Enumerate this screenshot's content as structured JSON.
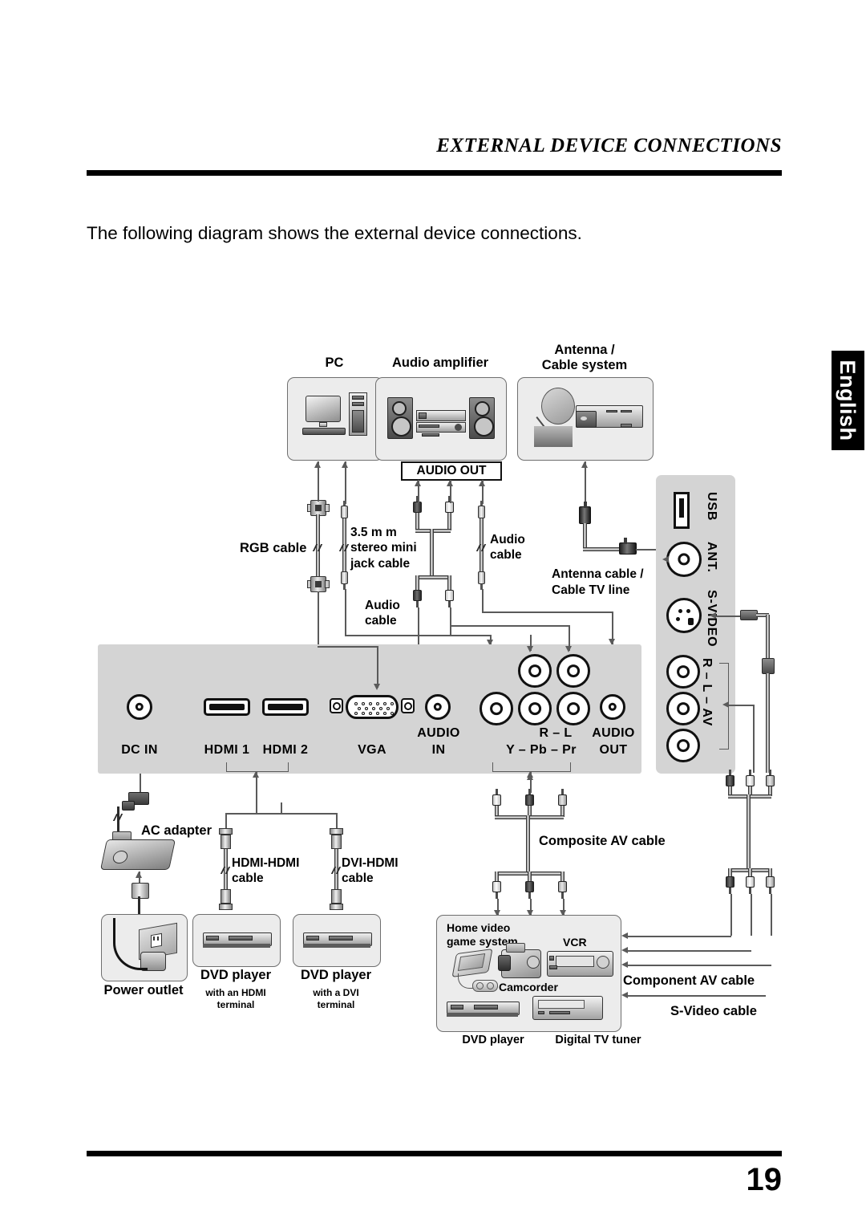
{
  "page": {
    "header_title": "EXTERNAL DEVICE CONNECTIONS",
    "intro_text": "The following diagram shows the external device connections.",
    "page_number": "19",
    "language_tab": "English"
  },
  "top_devices": [
    {
      "name": "pc",
      "label": "PC"
    },
    {
      "name": "audio-amplifier",
      "label": "Audio amplifier"
    },
    {
      "name": "antenna-cable-system",
      "label": "Antenna /\nCable system",
      "line1": "Antenna /",
      "line2": "Cable system"
    }
  ],
  "audio_out_box": {
    "label": "AUDIO OUT"
  },
  "cables_top": [
    {
      "name": "rgb-cable",
      "label": "RGB cable"
    },
    {
      "name": "stereo-mini-jack-cable",
      "l1": "3.5 m m",
      "l2": "stereo mini",
      "l3": "jack cable"
    },
    {
      "name": "audio-cable-upper",
      "l1": "Audio",
      "l2": "cable"
    },
    {
      "name": "audio-cable-lower",
      "l1": "Audio",
      "l2": "cable"
    },
    {
      "name": "antenna-cable",
      "l1": "Antenna cable /",
      "l2": "Cable TV line"
    }
  ],
  "panel_main": {
    "ports": [
      {
        "name": "dc-in",
        "label": "DC IN"
      },
      {
        "name": "hdmi-1",
        "label": "HDMI 1"
      },
      {
        "name": "hdmi-2",
        "label": "HDMI 2"
      },
      {
        "name": "vga",
        "label": "VGA"
      },
      {
        "name": "audio-in",
        "line1": "AUDIO",
        "line2": "IN"
      },
      {
        "name": "component",
        "line1": "R  –  L",
        "line2": "Y  –  Pb  –  Pr"
      },
      {
        "name": "audio-out",
        "line1": "AUDIO",
        "line2": "OUT"
      }
    ]
  },
  "panel_side": {
    "ports": [
      {
        "name": "usb",
        "label": "USB"
      },
      {
        "name": "ant",
        "label": "ANT."
      },
      {
        "name": "s-video",
        "label": "S-VIDEO"
      },
      {
        "name": "av",
        "label": "R  –  L  –  AV"
      }
    ]
  },
  "bottom_left": {
    "ac_adapter": "AC adapter",
    "power_outlet": "Power outlet",
    "hdmi_hdmi_cable": {
      "l1": "HDMI-HDMI",
      "l2": "cable"
    },
    "dvi_hdmi_cable": {
      "l1": "DVI-HDMI",
      "l2": "cable"
    },
    "dvd_hdmi": {
      "title": "DVD player",
      "sub1": "with an HDMI",
      "sub2": "terminal"
    },
    "dvd_dvi": {
      "title": "DVD player",
      "sub1": "with a DVI",
      "sub2": "terminal"
    }
  },
  "bottom_right": {
    "composite_av_cable": "Composite AV cable",
    "component_av_cable": "Component AV cable",
    "s_video_cable": "S-Video cable",
    "group_box": {
      "home_video_game_system": {
        "l1": "Home video",
        "l2": "game system"
      },
      "camcorder": "Camcorder",
      "vcr": "VCR",
      "dvd_player": "DVD player",
      "digital_tv_tuner": "Digital TV tuner"
    }
  },
  "colors": {
    "panel_gray": "#d4d4d4",
    "device_box_fill": "#ececec",
    "wire": "#5a5a5a",
    "rule": "#000000"
  }
}
